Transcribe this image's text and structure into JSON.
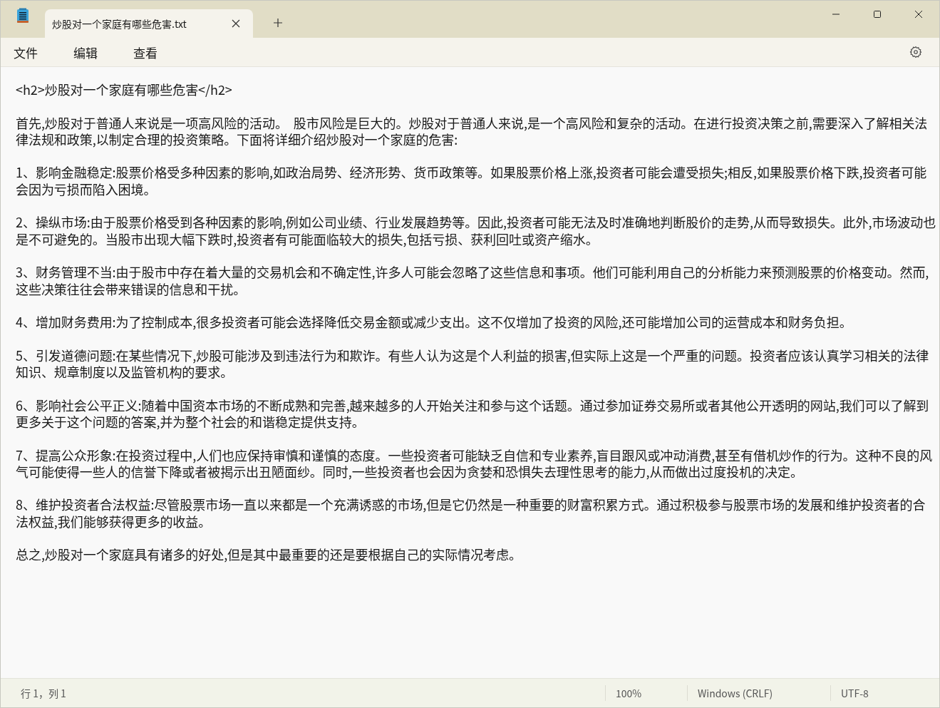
{
  "tabs": [
    {
      "title": "炒股对一个家庭有哪些危害.txt",
      "selected": true
    }
  ],
  "menu": [
    "文件",
    "编辑",
    "查看"
  ],
  "document": {
    "paragraphs": [
      "<h2>炒股对一个家庭有哪些危害</h2>",
      "首先,炒股对于普通人来说是一项高风险的活动。  股市风险是巨大的。炒股对于普通人来说,是一个高风险和复杂的活动。在进行投资决策之前,需要深入了解相关法律法规和政策,以制定合理的投资策略。下面将详细介绍炒股对一个家庭的危害:",
      "1、影响金融稳定:股票价格受多种因素的影响,如政治局势、经济形势、货币政策等。如果股票价格上涨,投资者可能会遭受损失;相反,如果股票价格下跌,投资者可能会因为亏损而陷入困境。",
      "2、操纵市场:由于股票价格受到各种因素的影响,例如公司业绩、行业发展趋势等。因此,投资者可能无法及时准确地判断股价的走势,从而导致损失。此外,市场波动也是不可避免的。当股市出现大幅下跌时,投资者有可能面临较大的损失,包括亏损、获利回吐或资产缩水。",
      "3、财务管理不当:由于股市中存在着大量的交易机会和不确定性,许多人可能会忽略了这些信息和事项。他们可能利用自己的分析能力来预测股票的价格变动。然而,这些决策往往会带来错误的信息和干扰。",
      "4、增加财务费用:为了控制成本,很多投资者可能会选择降低交易金额或减少支出。这不仅增加了投资的风险,还可能增加公司的运营成本和财务负担。",
      "5、引发道德问题:在某些情况下,炒股可能涉及到违法行为和欺诈。有些人认为这是个人利益的损害,但实际上这是一个严重的问题。投资者应该认真学习相关的法律知识、规章制度以及监管机构的要求。",
      "6、影响社会公平正义:随着中国资本市场的不断成熟和完善,越来越多的人开始关注和参与这个话题。通过参加证券交易所或者其他公开透明的网站,我们可以了解到更多关于这个问题的答案,并为整个社会的和谐稳定提供支持。",
      "7、提高公众形象:在投资过程中,人们也应保持审慎和谨慎的态度。一些投资者可能缺乏自信和专业素养,盲目跟风或冲动消费,甚至有借机炒作的行为。这种不良的风气可能使得一些人的信誉下降或者被揭示出丑陋面纱。同时,一些投资者也会因为贪婪和恐惧失去理性思考的能力,从而做出过度投机的决定。",
      "8、维护投资者合法权益:尽管股票市场一直以来都是一个充满诱惑的市场,但是它仍然是一种重要的财富积累方式。通过积极参与股票市场的发展和维护投资者的合法权益,我们能够获得更多的收益。",
      "总之,炒股对一个家庭具有诸多的好处,但是其中最重要的还是要根据自己的实际情况考虑。"
    ]
  },
  "status_bar": {
    "position": "行 1，列 1",
    "zoom": "100%",
    "line_ending": "Windows (CRLF)",
    "encoding": "UTF-8"
  }
}
